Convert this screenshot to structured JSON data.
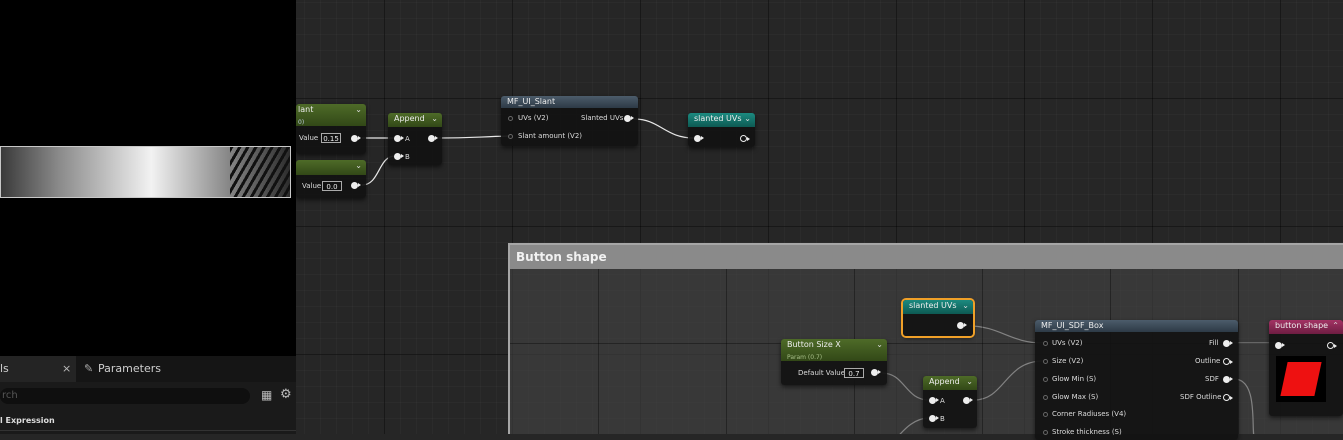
{
  "left_panel": {
    "tabs": {
      "details_label": "ls",
      "close_symbol": "×",
      "parameters_label": "Parameters"
    },
    "search_placeholder": "rch",
    "section_header": "l Expression",
    "icons": [
      "pencil-icon",
      "table-view-icon",
      "settings-gear-icon"
    ]
  },
  "nodes": {
    "param1": {
      "title": "lant",
      "title_sub": "0)",
      "value_label": "Value",
      "value": "0.15",
      "color": "#4e6b28"
    },
    "param2": {
      "title": "",
      "value_label": "Value",
      "value": "0.0",
      "color": "#4e6b28"
    },
    "append1": {
      "title": "Append",
      "pin_a": "A",
      "pin_b": "B"
    },
    "slant": {
      "title": "MF_UI_Slant",
      "input_uvs": "UVs (V2)",
      "input_amount": "Slant amount (V2)",
      "output": "Slanted UVs",
      "color": "#4c5c6b"
    },
    "slanted_uvs_out": {
      "title": "slanted UVs",
      "color": "#1c8a80"
    },
    "slanted_uvs_in": {
      "title": "slanted UVs",
      "color": "#1c8a80"
    },
    "button_size_x": {
      "title": "Button Size X",
      "subtitle": "Param (0.7)",
      "value_label": "Default Value",
      "value": "0.7"
    },
    "append2": {
      "title": "Append",
      "pin_a": "A",
      "pin_b": "B"
    },
    "sdf_box": {
      "title": "MF_UI_SDF_Box",
      "inputs": [
        "UVs (V2)",
        "Size (V2)",
        "Glow Min (S)",
        "Glow Max (S)",
        "Corner Radiuses (V4)",
        "Stroke thickness (S)"
      ],
      "outputs": [
        "Fill",
        "Outline",
        "SDF",
        "SDF Outline"
      ],
      "color": "#4c5c6b"
    },
    "button_shape": {
      "title": "button shape",
      "color": "#a33364",
      "preview_color": "#ee1111"
    }
  },
  "comment": {
    "title": "Button shape"
  }
}
